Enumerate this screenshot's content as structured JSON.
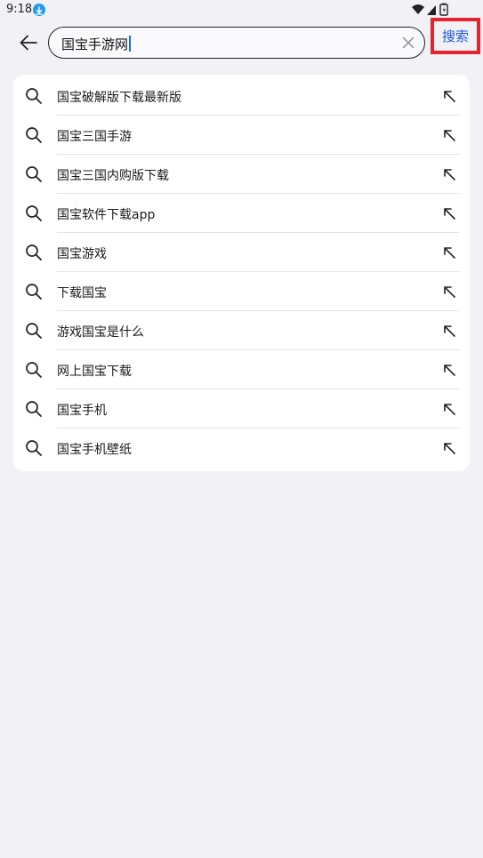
{
  "status_bar": {
    "time": "9:18"
  },
  "search": {
    "query": "国宝手游网",
    "submit_label": "搜索"
  },
  "suggestions": [
    {
      "label": "国宝破解版下载最新版"
    },
    {
      "label": "国宝三国手游"
    },
    {
      "label": "国宝三国内购版下载"
    },
    {
      "label": "国宝软件下载app"
    },
    {
      "label": "国宝游戏"
    },
    {
      "label": "下载国宝"
    },
    {
      "label": "游戏国宝是什么"
    },
    {
      "label": "网上国宝下载"
    },
    {
      "label": "国宝手机"
    },
    {
      "label": "国宝手机壁纸"
    }
  ],
  "icons": {
    "back": "back-arrow-icon",
    "clear": "close-icon",
    "suggestion": "search-icon",
    "fill": "arrow-up-left-icon"
  },
  "colors": {
    "background": "#f1f1f6",
    "accent": "#1c57e0",
    "highlight": "#e8232b",
    "download_badge": "#1e9bf0"
  }
}
